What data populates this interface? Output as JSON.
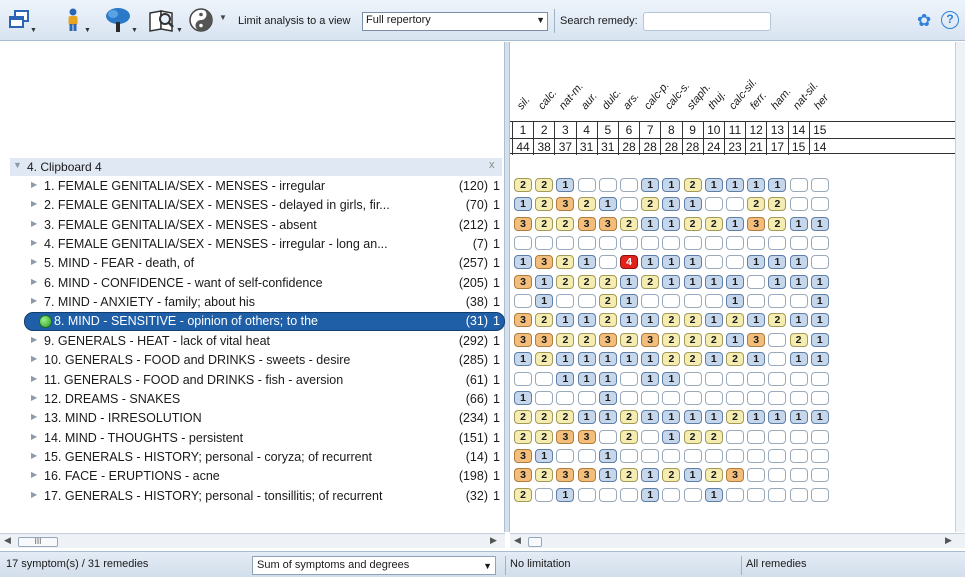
{
  "toolbar": {
    "tools": [
      {
        "icon": "windows-icon"
      },
      {
        "icon": "figure-icon"
      },
      {
        "icon": "tree-icon"
      },
      {
        "icon": "book-search-icon"
      },
      {
        "icon": "yin-yang-icon"
      }
    ],
    "limit_label": "Limit analysis to a view",
    "view_select_value": "Full repertory",
    "search_label": "Search remedy:",
    "search_placeholder": "",
    "settings_icon": "gear-icon",
    "help_icon": "help-icon",
    "help_glyph": "?"
  },
  "clipboard": {
    "label": "4. Clipboard 4",
    "close_glyph": "x"
  },
  "symptoms": [
    {
      "label": "1. FEMALE GENITALIA/SEX - MENSES - irregular",
      "count": "(120)",
      "flag": "1"
    },
    {
      "label": "2. FEMALE GENITALIA/SEX - MENSES - delayed in girls, fir...",
      "count": "(70)",
      "flag": "1"
    },
    {
      "label": "3. FEMALE GENITALIA/SEX - MENSES - absent",
      "count": "(212)",
      "flag": "1"
    },
    {
      "label": "4. FEMALE GENITALIA/SEX - MENSES - irregular - long an...",
      "count": "(7)",
      "flag": "1"
    },
    {
      "label": "5. MIND - FEAR - death, of",
      "count": "(257)",
      "flag": "1"
    },
    {
      "label": "6. MIND - CONFIDENCE - want of self-confidence",
      "count": "(205)",
      "flag": "1"
    },
    {
      "label": "7. MIND - ANXIETY - family; about his",
      "count": "(38)",
      "flag": "1"
    },
    {
      "label": "8. MIND - SENSITIVE - opinion of others; to the",
      "count": "(31)",
      "flag": "1",
      "selected": true
    },
    {
      "label": "9. GENERALS - HEAT - lack of vital heat",
      "count": "(292)",
      "flag": "1"
    },
    {
      "label": "10. GENERALS - FOOD and DRINKS - sweets - desire",
      "count": "(285)",
      "flag": "1"
    },
    {
      "label": "11. GENERALS - FOOD and DRINKS - fish - aversion",
      "count": "(61)",
      "flag": "1"
    },
    {
      "label": "12. DREAMS - SNAKES",
      "count": "(66)",
      "flag": "1"
    },
    {
      "label": "13. MIND - IRRESOLUTION",
      "count": "(234)",
      "flag": "1"
    },
    {
      "label": "14. MIND - THOUGHTS - persistent",
      "count": "(151)",
      "flag": "1"
    },
    {
      "label": "15. GENERALS - HISTORY; personal - coryza; of recurrent",
      "count": "(14)",
      "flag": "1"
    },
    {
      "label": "16. FACE - ERUPTIONS - acne",
      "count": "(198)",
      "flag": "1"
    },
    {
      "label": "17. GENERALS - HISTORY; personal - tonsillitis; of recurrent",
      "count": "(32)",
      "flag": "1"
    }
  ],
  "remedies": [
    {
      "name": "sil.",
      "num": "1",
      "score": "44"
    },
    {
      "name": "calc.",
      "num": "2",
      "score": "38"
    },
    {
      "name": "nat-m.",
      "num": "3",
      "score": "37"
    },
    {
      "name": "aur.",
      "num": "4",
      "score": "31"
    },
    {
      "name": "dulc.",
      "num": "5",
      "score": "31"
    },
    {
      "name": "ars.",
      "num": "6",
      "score": "28"
    },
    {
      "name": "calc-p.",
      "num": "7",
      "score": "28"
    },
    {
      "name": "calc-s.",
      "num": "8",
      "score": "28"
    },
    {
      "name": "staph.",
      "num": "9",
      "score": "28"
    },
    {
      "name": "thuj.",
      "num": "10",
      "score": "24"
    },
    {
      "name": "calc-sil.",
      "num": "11",
      "score": "23"
    },
    {
      "name": "ferr.",
      "num": "12",
      "score": "21"
    },
    {
      "name": "ham.",
      "num": "13",
      "score": "17"
    },
    {
      "name": "nat-sil.",
      "num": "14",
      "score": "15"
    },
    {
      "name": "her",
      "num": "15",
      "score": "14"
    }
  ],
  "grid": [
    [
      2,
      2,
      1,
      0,
      0,
      0,
      1,
      1,
      2,
      1,
      1,
      1,
      1,
      0,
      0
    ],
    [
      1,
      2,
      3,
      2,
      1,
      0,
      2,
      1,
      1,
      0,
      0,
      2,
      2,
      0,
      0
    ],
    [
      3,
      2,
      2,
      3,
      3,
      2,
      1,
      1,
      2,
      2,
      1,
      3,
      2,
      1,
      1
    ],
    [
      0,
      0,
      0,
      0,
      0,
      0,
      0,
      0,
      0,
      0,
      0,
      0,
      0,
      0,
      0
    ],
    [
      1,
      3,
      2,
      1,
      0,
      4,
      1,
      1,
      1,
      0,
      0,
      1,
      1,
      1,
      0
    ],
    [
      3,
      1,
      2,
      2,
      2,
      1,
      2,
      1,
      1,
      1,
      1,
      0,
      1,
      1,
      1
    ],
    [
      0,
      1,
      0,
      0,
      2,
      1,
      0,
      0,
      0,
      0,
      1,
      0,
      0,
      0,
      1
    ],
    [
      3,
      2,
      1,
      1,
      2,
      1,
      1,
      2,
      2,
      1,
      2,
      1,
      2,
      1,
      1
    ],
    [
      3,
      3,
      2,
      2,
      3,
      2,
      3,
      2,
      2,
      2,
      1,
      3,
      0,
      2,
      1
    ],
    [
      1,
      2,
      1,
      1,
      1,
      1,
      1,
      2,
      2,
      1,
      2,
      1,
      0,
      1,
      1
    ],
    [
      0,
      0,
      1,
      1,
      1,
      0,
      1,
      1,
      0,
      0,
      0,
      0,
      0,
      0,
      0
    ],
    [
      1,
      0,
      0,
      0,
      1,
      0,
      0,
      0,
      0,
      0,
      0,
      0,
      0,
      0,
      0
    ],
    [
      2,
      2,
      2,
      1,
      1,
      2,
      1,
      1,
      1,
      1,
      2,
      1,
      1,
      1,
      1
    ],
    [
      2,
      2,
      3,
      3,
      0,
      2,
      0,
      1,
      2,
      2,
      0,
      0,
      0,
      0,
      0
    ],
    [
      3,
      1,
      0,
      0,
      1,
      0,
      0,
      0,
      0,
      0,
      0,
      0,
      0,
      0,
      0
    ],
    [
      3,
      2,
      3,
      3,
      1,
      2,
      1,
      2,
      1,
      2,
      3,
      0,
      0,
      0,
      0
    ],
    [
      2,
      0,
      1,
      0,
      0,
      0,
      1,
      0,
      0,
      1,
      0,
      0,
      0,
      0,
      0
    ]
  ],
  "grade_colors": {
    "1": "#c6d7ec",
    "2": "#f4ecb0",
    "3": "#f3be7c",
    "4": "#e3231b"
  },
  "status": {
    "count": "17 symptom(s) / 31 remedies",
    "method": "Sum of symptoms and degrees",
    "limitation": "No limitation",
    "remedy_filter": "All remedies"
  },
  "scroll": {
    "thumb_glyph": "III"
  }
}
